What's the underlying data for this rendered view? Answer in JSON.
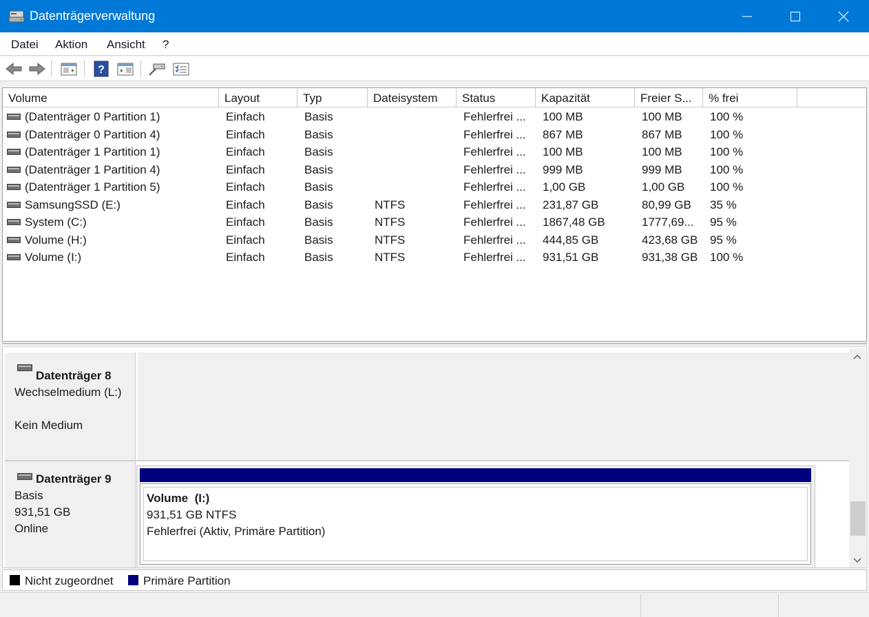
{
  "window": {
    "title": "Datenträgerverwaltung",
    "accent_color": "#0078d7"
  },
  "menu": {
    "items": [
      {
        "label": "Datei"
      },
      {
        "label": "Aktion"
      },
      {
        "label": "Ansicht"
      },
      {
        "label": "?"
      }
    ]
  },
  "toolbar": {
    "icons": [
      "back-arrow-icon",
      "forward-arrow-icon",
      "properties-pane-icon",
      "help-icon",
      "show-pane-icon",
      "connect-icon",
      "checklist-icon"
    ]
  },
  "volume_list": {
    "columns": [
      "Volume",
      "Layout",
      "Typ",
      "Dateisystem",
      "Status",
      "Kapazität",
      "Freier S...",
      "% frei"
    ],
    "rows": [
      [
        "(Datenträger 0 Partition 1)",
        "Einfach",
        "Basis",
        "",
        "Fehlerfrei ...",
        "100 MB",
        "100 MB",
        "100 %"
      ],
      [
        "(Datenträger 0 Partition 4)",
        "Einfach",
        "Basis",
        "",
        "Fehlerfrei ...",
        "867 MB",
        "867 MB",
        "100 %"
      ],
      [
        "(Datenträger 1 Partition 1)",
        "Einfach",
        "Basis",
        "",
        "Fehlerfrei ...",
        "100 MB",
        "100 MB",
        "100 %"
      ],
      [
        "(Datenträger 1 Partition 4)",
        "Einfach",
        "Basis",
        "",
        "Fehlerfrei ...",
        "999 MB",
        "999 MB",
        "100 %"
      ],
      [
        "(Datenträger 1 Partition 5)",
        "Einfach",
        "Basis",
        "",
        "Fehlerfrei ...",
        "1,00 GB",
        "1,00 GB",
        "100 %"
      ],
      [
        "SamsungSSD (E:)",
        "Einfach",
        "Basis",
        "NTFS",
        "Fehlerfrei ...",
        "231,87 GB",
        "80,99 GB",
        "35 %"
      ],
      [
        "System (C:)",
        "Einfach",
        "Basis",
        "NTFS",
        "Fehlerfrei ...",
        "1867,48 GB",
        "1777,69...",
        "95 %"
      ],
      [
        "Volume (H:)",
        "Einfach",
        "Basis",
        "NTFS",
        "Fehlerfrei ...",
        "444,85 GB",
        "423,68 GB",
        "95 %"
      ],
      [
        "Volume (I:)",
        "Einfach",
        "Basis",
        "NTFS",
        "Fehlerfrei ...",
        "931,51 GB",
        "931,38 GB",
        "100 %"
      ]
    ]
  },
  "disks": [
    {
      "name": "Datenträger 8",
      "lines": [
        "Wechselmedium (L:)",
        "",
        "Kein Medium"
      ]
    },
    {
      "name": "Datenträger 9",
      "lines": [
        "Basis",
        "931,51 GB",
        "Online"
      ],
      "volume": {
        "title": "Volume  (I:)",
        "size": "931,51 GB NTFS",
        "status": "Fehlerfrei (Aktiv, Primäre Partition)",
        "bar_color": "#00007f"
      }
    }
  ],
  "legend": [
    {
      "label": "Nicht zugeordnet",
      "color": "#000000"
    },
    {
      "label": "Primäre Partition",
      "color": "#00007f"
    }
  ]
}
